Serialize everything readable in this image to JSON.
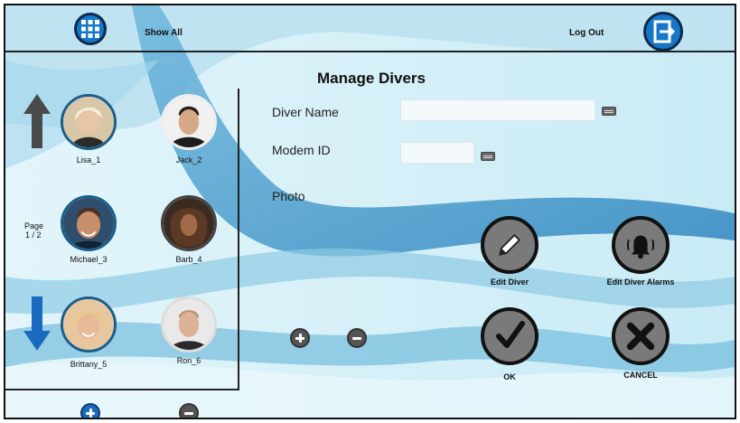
{
  "header": {
    "show_all_label": "Show All",
    "logout_label": "Log Out",
    "grid_icon": "grid-menu-icon",
    "logout_icon": "logout-door-icon"
  },
  "title": "Manage Divers",
  "sidebar": {
    "page_label": "Page",
    "page_number": "1 / 2",
    "up_icon": "arrow-up-icon",
    "down_icon": "arrow-down-icon",
    "divers": [
      {
        "name": "Lisa_1"
      },
      {
        "name": "Jack_2"
      },
      {
        "name": "Michael_3"
      },
      {
        "name": "Barb_4"
      },
      {
        "name": "Brittany_5"
      },
      {
        "name": "Ron_6"
      }
    ]
  },
  "form": {
    "diver_name_label": "Diver Name",
    "diver_name_value": "",
    "modem_id_label": "Modem ID",
    "modem_id_value": "",
    "photo_label": "Photo"
  },
  "actions": {
    "edit_diver": "Edit Diver",
    "edit_diver_alarms": "Edit Diver Alarms",
    "ok": "OK",
    "cancel": "CANCEL"
  },
  "colors": {
    "accent_blue": "#1677c8",
    "arrow_down_blue": "#1a6bc0",
    "arrow_up_dark": "#4a4a4a",
    "button_gray": "#7a7a7a"
  }
}
